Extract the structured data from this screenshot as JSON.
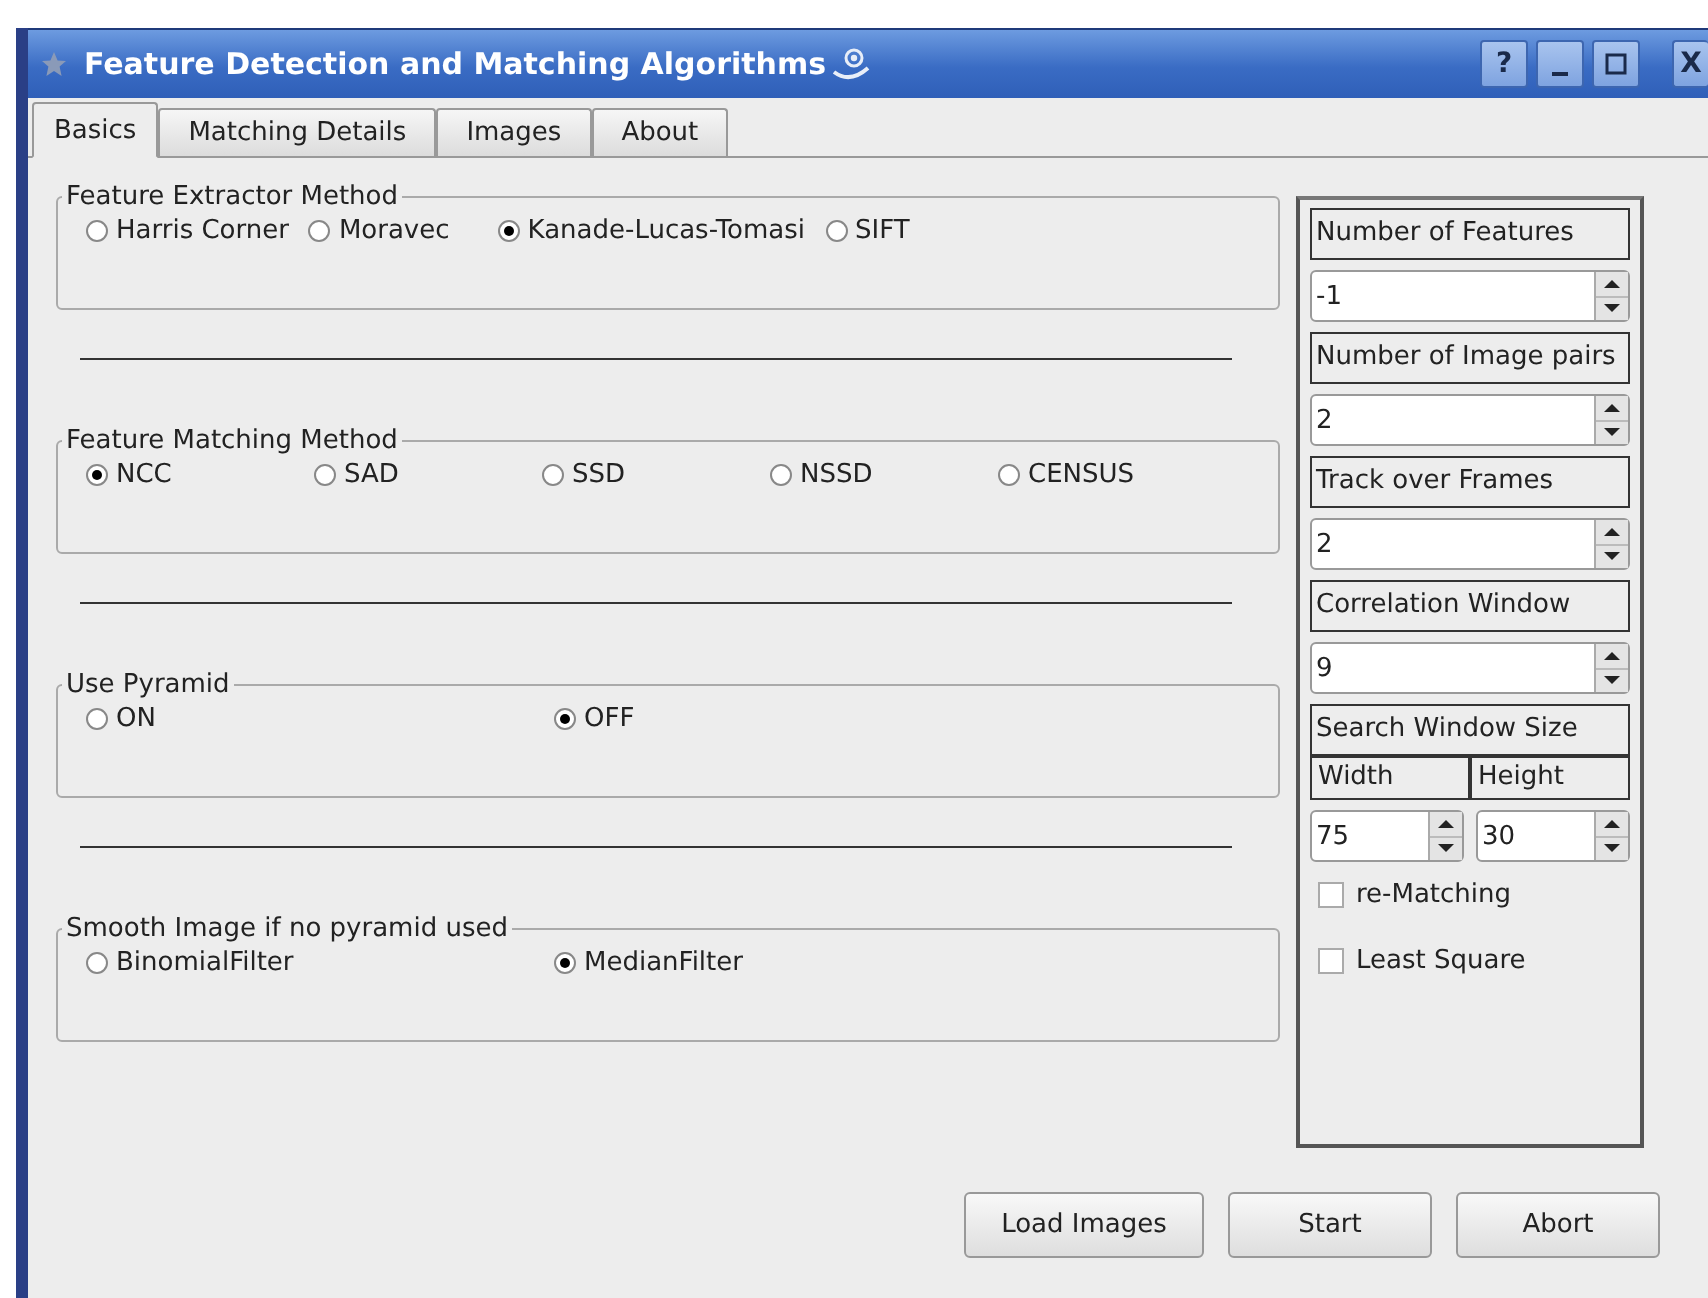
{
  "window": {
    "title": "Feature Detection and Matching Algorithms"
  },
  "title_buttons": [
    {
      "kind": "help",
      "label": "?"
    },
    {
      "kind": "minimize"
    },
    {
      "kind": "maximize"
    },
    {
      "kind": "close",
      "label": "X"
    }
  ],
  "tabs": [
    {
      "label": "Basics",
      "selected": true
    },
    {
      "label": "Matching Details",
      "selected": false
    },
    {
      "label": "Images",
      "selected": false
    },
    {
      "label": "About",
      "selected": false
    }
  ],
  "groups": [
    {
      "title": "Feature Extractor Method",
      "options": [
        {
          "label": "Harris Corner",
          "selected": false
        },
        {
          "label": "Moravec",
          "selected": false
        },
        {
          "label": "Kanade-Lucas-Tomasi",
          "selected": true
        },
        {
          "label": "SIFT",
          "selected": false
        }
      ]
    },
    {
      "title": "Feature Matching Method",
      "options": [
        {
          "label": "NCC",
          "selected": true
        },
        {
          "label": "SAD",
          "selected": false
        },
        {
          "label": "SSD",
          "selected": false
        },
        {
          "label": "NSSD",
          "selected": false
        },
        {
          "label": "CENSUS",
          "selected": false
        }
      ]
    },
    {
      "title": "Use Pyramid",
      "options": [
        {
          "label": "ON",
          "selected": false
        },
        {
          "label": "OFF",
          "selected": true
        }
      ]
    },
    {
      "title": "Smooth Image if no pyramid used",
      "options": [
        {
          "label": "BinomialFilter",
          "selected": false
        },
        {
          "label": "MedianFilter",
          "selected": true
        }
      ]
    }
  ],
  "side_panel": [
    {
      "kind": "label",
      "text": "Number of Features"
    },
    {
      "kind": "spin",
      "value": "-1"
    },
    {
      "kind": "label",
      "text": "Number of Image pairs"
    },
    {
      "kind": "spin",
      "value": "2"
    },
    {
      "kind": "label",
      "text": "Track over Frames"
    },
    {
      "kind": "spin",
      "value": "2"
    },
    {
      "kind": "label",
      "text": "Correlation Window"
    },
    {
      "kind": "spin",
      "value": "9"
    },
    {
      "kind": "label",
      "text": "Search Window Size"
    },
    {
      "kind": "pair_labels",
      "texts": [
        "Width",
        "Height"
      ]
    },
    {
      "kind": "pair_spins",
      "values": [
        "75",
        "30"
      ]
    },
    {
      "kind": "checkbox",
      "label": "re-Matching",
      "checked": false
    },
    {
      "kind": "checkbox",
      "label": "Least Square",
      "checked": false
    }
  ],
  "buttons": [
    "Load Images",
    "Start",
    "Abort"
  ]
}
